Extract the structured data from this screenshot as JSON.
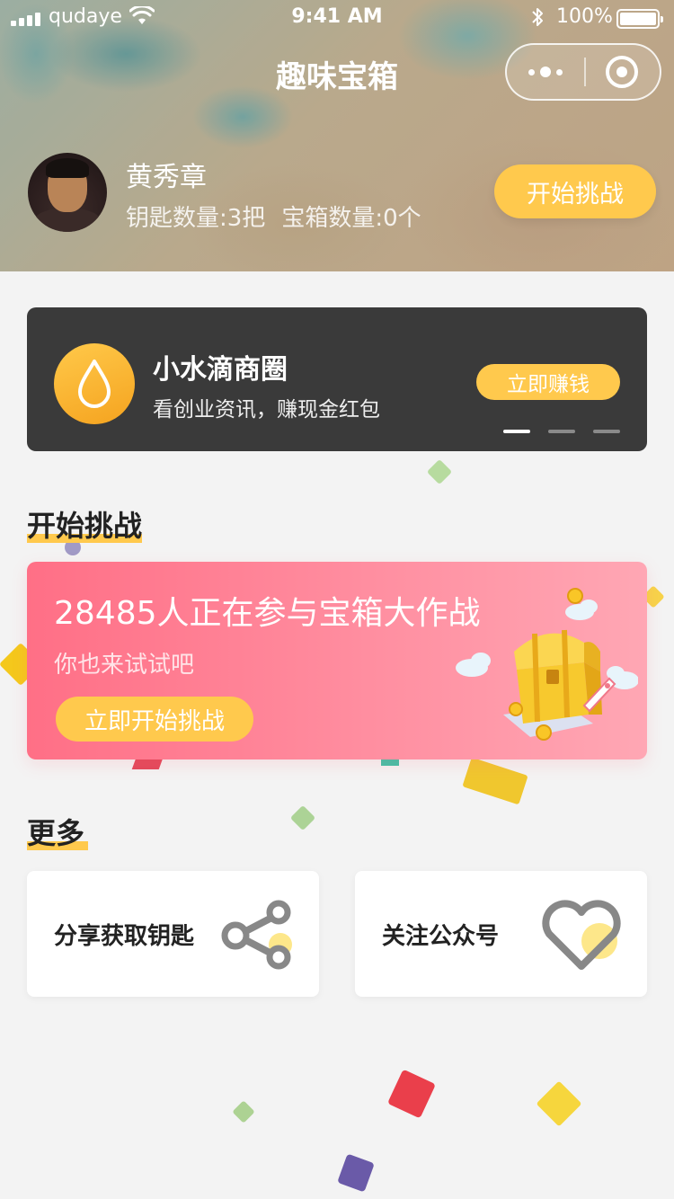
{
  "status_bar": {
    "carrier": "qudaye",
    "time": "9:41 AM",
    "battery": "100%"
  },
  "nav": {
    "title": "趣味宝箱"
  },
  "user": {
    "name": "黄秀章",
    "keys": "钥匙数量:3把",
    "chests": "宝箱数量:0个",
    "start_button": "开始挑战"
  },
  "banner": {
    "title": "小水滴商圈",
    "subtitle": "看创业资讯，赚现金红包",
    "button": "立即赚钱",
    "active_slide": 1,
    "slide_count": 3
  },
  "challenge": {
    "section_title": "开始挑战",
    "count_text": "28485人正在参与宝箱大作战",
    "subtitle": "你也来试试吧",
    "button": "立即开始挑战"
  },
  "more": {
    "section_title": "更多",
    "share_label": "分享获取钥匙",
    "follow_label": "关注公众号"
  },
  "colors": {
    "accent": "#ffc94d",
    "banner_bg": "#3a3a3a",
    "challenge_gradient_start": "#ff6f86",
    "challenge_gradient_end": "#ffa7b4",
    "page_bg": "#f3f3f3"
  },
  "icons": {
    "drop": "water-drop-icon",
    "share": "share-icon",
    "heart": "heart-icon",
    "more": "more-dots-icon",
    "close": "close-target-icon"
  }
}
